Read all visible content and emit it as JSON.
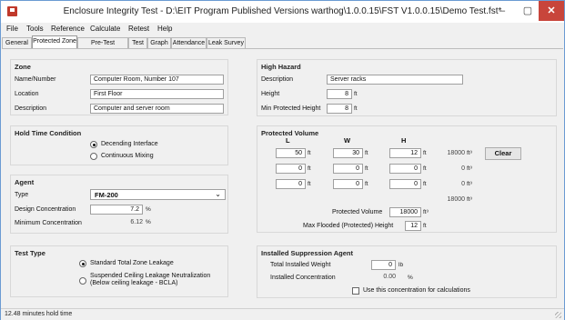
{
  "window": {
    "title": "Enclosure Integrity Test - D:\\EIT Program Published Versions warthog\\1.0.0.15\\FST V1.0.0.15\\Demo Test.fst*",
    "minimize": "–",
    "maximize": "▢",
    "close": "✕"
  },
  "menu": [
    "File",
    "Tools",
    "Reference",
    "Calculate",
    "Retest",
    "Help"
  ],
  "tabs": [
    "General",
    "Protected Zone",
    "Pre-Test Checklist",
    "Test",
    "Graph",
    "Attendance",
    "Leak Survey"
  ],
  "zone": {
    "title": "Zone",
    "name_label": "Name/Number",
    "name_value": "Computer Room, Number 107",
    "location_label": "Location",
    "location_value": "First Floor",
    "description_label": "Description",
    "description_value": "Computer and server room"
  },
  "hold_time": {
    "title": "Hold Time Condition",
    "option1": "Decending Interface",
    "option2": "Continuous Mixing",
    "selected": "Decending Interface"
  },
  "agent": {
    "title": "Agent",
    "type_label": "Type",
    "type_value": "FM-200",
    "design_label": "Design Concentration",
    "design_value": "7.2",
    "min_label": "Minimum Concentration",
    "min_value": "6.12",
    "pct": "%"
  },
  "test_type": {
    "title": "Test Type",
    "option1": "Standard Total Zone Leakage",
    "option2_line1": "Suspended Ceiling Leakage Neutralization",
    "option2_line2": "(Below ceiling leakage - BCLA)",
    "selected": "Standard Total Zone Leakage"
  },
  "high_hazard": {
    "title": "High Hazard",
    "description_label": "Description",
    "description_value": "Server racks",
    "height_label": "Height",
    "height_value": "8",
    "min_height_label": "Min Protected Height",
    "min_height_value": "8",
    "unit": "ft"
  },
  "protected_volume": {
    "title": "Protected Volume",
    "col_l": "L",
    "col_w": "W",
    "col_h": "H",
    "rows": [
      {
        "l": "50",
        "w": "30",
        "h": "12",
        "vol": "18000"
      },
      {
        "l": "0",
        "w": "0",
        "h": "0",
        "vol": "0"
      },
      {
        "l": "0",
        "w": "0",
        "h": "0",
        "vol": "0"
      }
    ],
    "unit_ft": "ft",
    "unit_ft3": "ft³",
    "total": "18000",
    "clear_label": "Clear",
    "pv_label": "Protected Volume",
    "pv_value": "18000",
    "max_flooded_label": "Max Flooded (Protected) Height",
    "max_flooded_value": "12"
  },
  "suppression": {
    "title": "Installed Suppression Agent",
    "weight_label": "Total Installed Weight",
    "weight_value": "0",
    "weight_unit": "lb",
    "conc_label": "Installed Concentration",
    "conc_value": "0.00",
    "conc_unit": "%",
    "use_label": "Use this concentration for calculations",
    "use_checked": false
  },
  "status": {
    "text": "12.48 minutes hold time"
  }
}
